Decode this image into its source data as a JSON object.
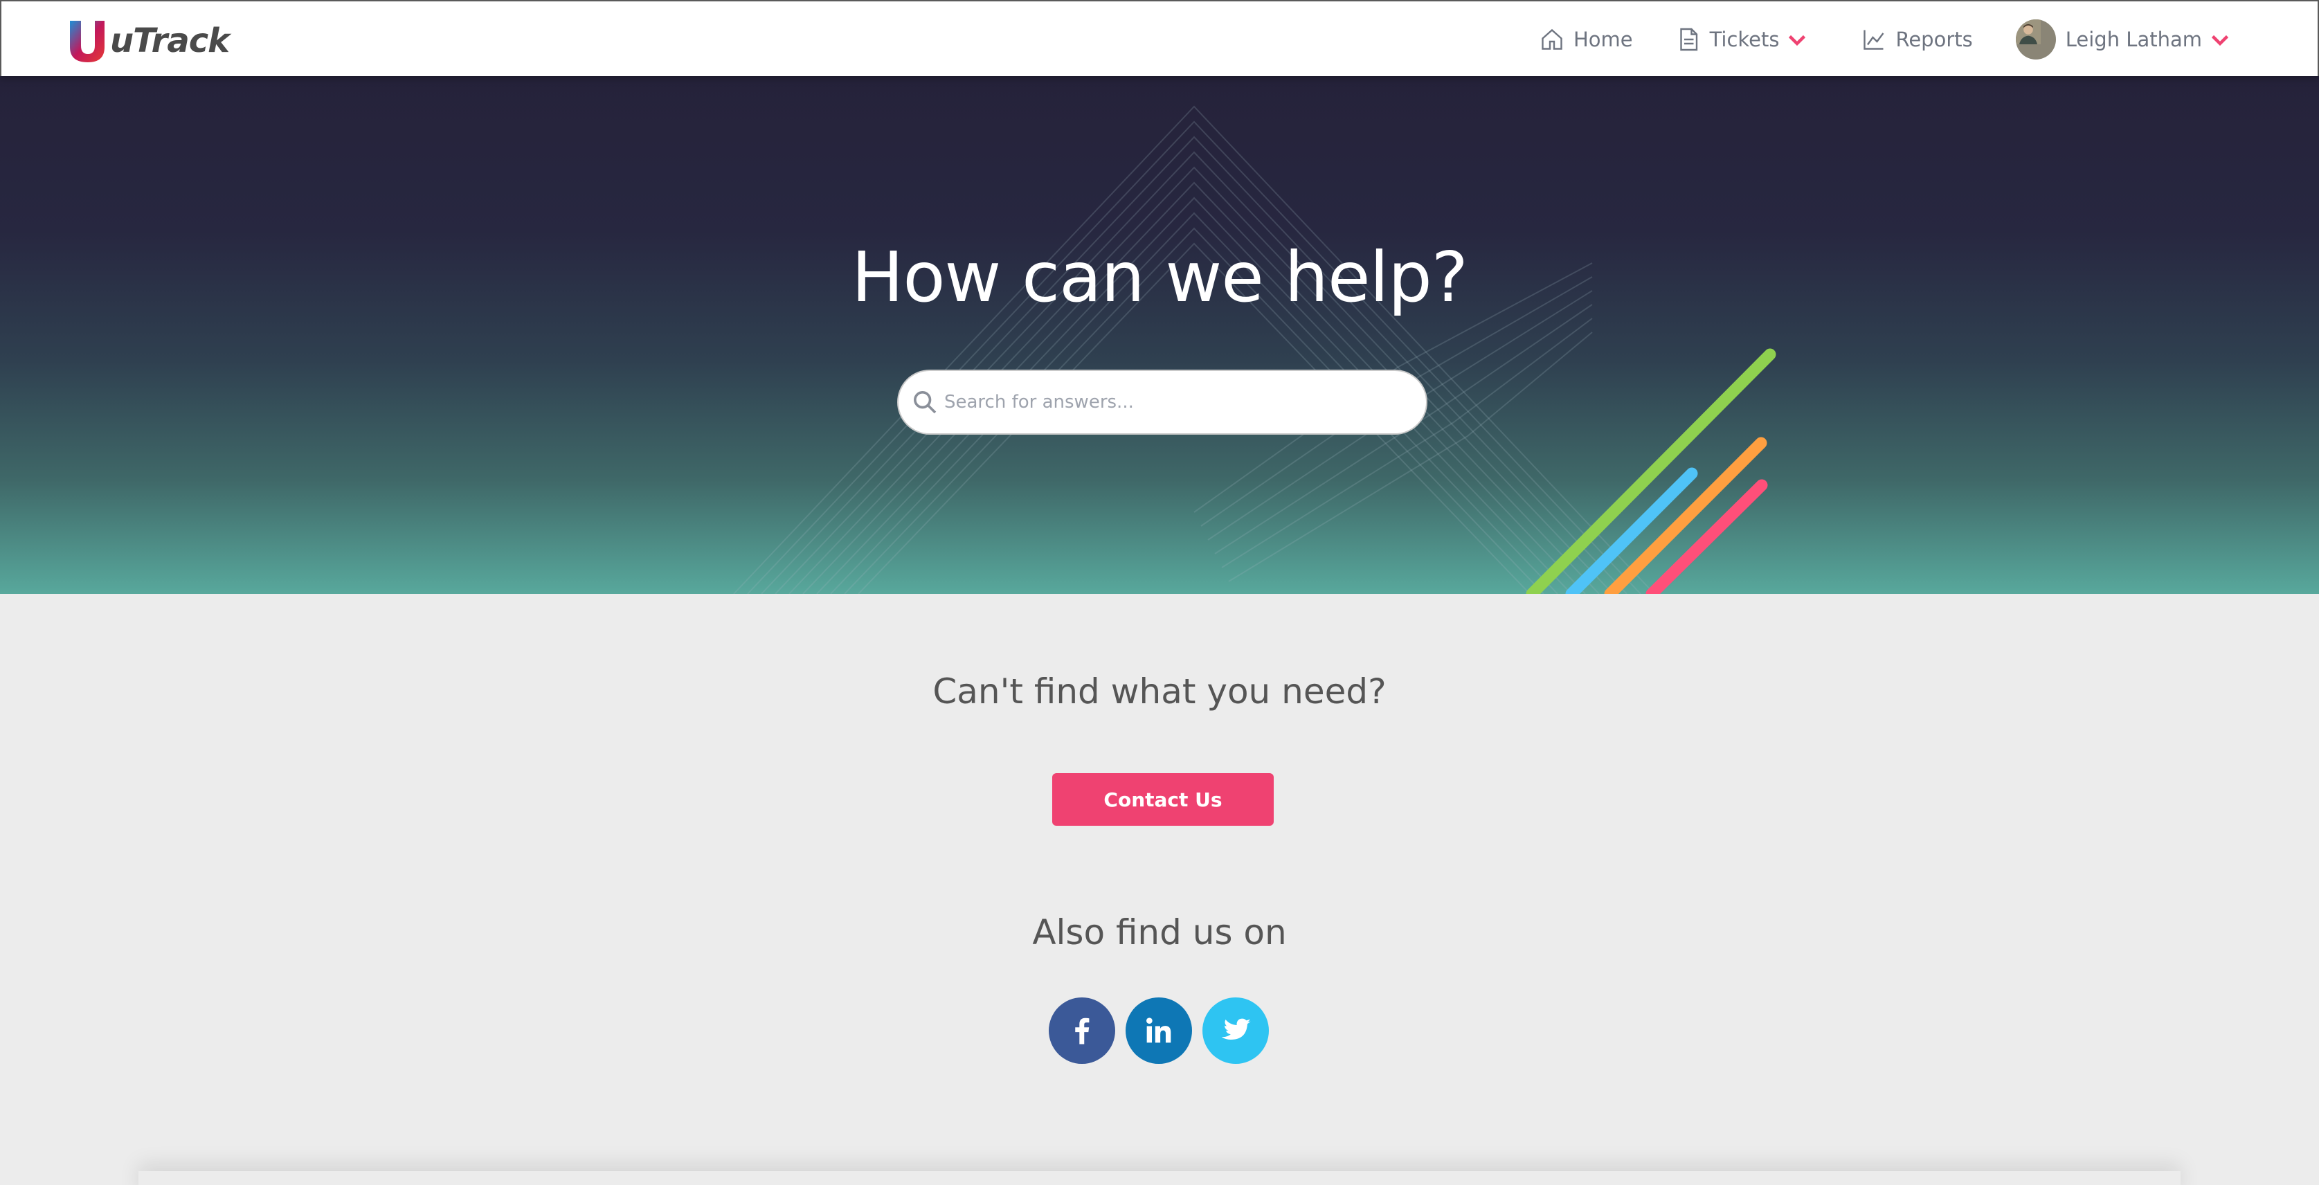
{
  "app": {
    "name": "uTrack"
  },
  "nav": {
    "home": "Home",
    "tickets": "Tickets",
    "reports": "Reports",
    "user": "Leigh Latham"
  },
  "hero": {
    "title": "How can we help?",
    "search_placeholder": "Search for answers..."
  },
  "support": {
    "heading": "Can't find what you need?",
    "contact_label": "Contact Us",
    "social_heading": "Also find us on",
    "networks": [
      "facebook",
      "linkedin",
      "twitter"
    ]
  },
  "colors": {
    "accent": "#ef4271",
    "facebook": "#3b5998",
    "linkedin": "#0e77b5",
    "twitter": "#2ec4f2",
    "stripe_green": "#8fd14f",
    "stripe_blue": "#4fc3f7",
    "stripe_orange": "#ff9f40",
    "stripe_pink": "#ff4f79"
  }
}
